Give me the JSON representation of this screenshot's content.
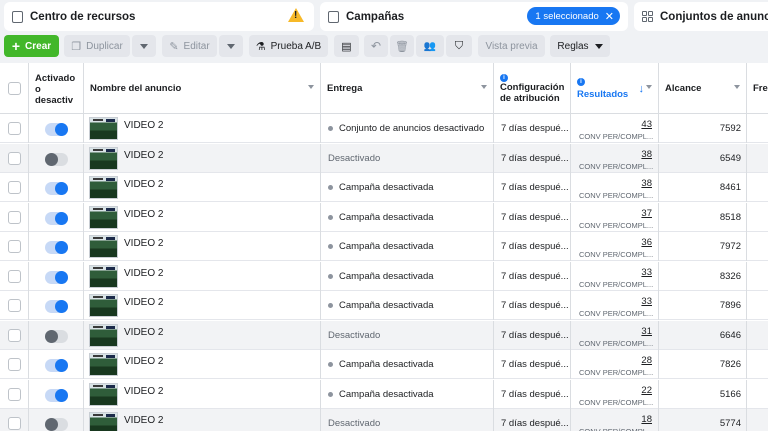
{
  "nav": {
    "tab1": "Centro de recursos",
    "tab2": "Campañas",
    "selected_badge": "1 seleccionado",
    "tab3": "Conjuntos de anuncios p"
  },
  "toolbar": {
    "create": "Crear",
    "duplicate": "Duplicar",
    "edit": "Editar",
    "ab_test": "Prueba A/B",
    "preview": "Vista previa",
    "rules": "Reglas"
  },
  "columns": {
    "status": "Activado o desactiv",
    "name": "Nombre del anuncio",
    "delivery": "Entrega",
    "attribution": "Configuración de atribución",
    "results": "Resultados",
    "reach": "Alcance",
    "freq": "Fre"
  },
  "rows": [
    {
      "on": true,
      "name": "VIDEO 2",
      "delivery": "Conjunto de anuncios desactivado",
      "dot": true,
      "attr": "7 días despué...",
      "results": "43",
      "sub": "CONV PER/COMPL...",
      "reach": "7592"
    },
    {
      "on": false,
      "name": "VIDEO 2",
      "delivery": "Desactivado",
      "dot": false,
      "attr": "7 días despué...",
      "results": "38",
      "sub": "CONV PER/COMPL...",
      "reach": "6549"
    },
    {
      "on": true,
      "name": "VIDEO 2",
      "delivery": "Campaña desactivada",
      "dot": true,
      "attr": "7 días despué...",
      "results": "38",
      "sub": "CONV PER/COMPL...",
      "reach": "8461"
    },
    {
      "on": true,
      "name": "VIDEO 2",
      "delivery": "Campaña desactivada",
      "dot": true,
      "attr": "7 días despué...",
      "results": "37",
      "sub": "CONV PER/COMPL...",
      "reach": "8518"
    },
    {
      "on": true,
      "name": "VIDEO 2",
      "delivery": "Campaña desactivada",
      "dot": true,
      "attr": "7 días despué...",
      "results": "36",
      "sub": "CONV PER/COMPL...",
      "reach": "7972"
    },
    {
      "on": true,
      "name": "VIDEO 2",
      "delivery": "Campaña desactivada",
      "dot": true,
      "attr": "7 días despué...",
      "results": "33",
      "sub": "CONV PER/COMPL...",
      "reach": "8326"
    },
    {
      "on": true,
      "name": "VIDEO 2",
      "delivery": "Campaña desactivada",
      "dot": true,
      "attr": "7 días despué...",
      "results": "33",
      "sub": "CONV PER/COMPL...",
      "reach": "7896"
    },
    {
      "on": false,
      "name": "VIDEO 2",
      "delivery": "Desactivado",
      "dot": false,
      "attr": "7 días despué...",
      "results": "31",
      "sub": "CONV PER/COMPL...",
      "reach": "6646"
    },
    {
      "on": true,
      "name": "VIDEO 2",
      "delivery": "Campaña desactivada",
      "dot": true,
      "attr": "7 días despué...",
      "results": "28",
      "sub": "CONV PER/COMPL...",
      "reach": "7826"
    },
    {
      "on": true,
      "name": "VIDEO 2",
      "delivery": "Campaña desactivada",
      "dot": true,
      "attr": "7 días despué...",
      "results": "22",
      "sub": "CONV PER/COMPL...",
      "reach": "5166"
    },
    {
      "on": false,
      "name": "VIDEO 2",
      "delivery": "Desactivado",
      "dot": false,
      "attr": "7 días despué...",
      "results": "18",
      "sub": "CONV PER/COMPL...",
      "reach": "5774"
    }
  ]
}
